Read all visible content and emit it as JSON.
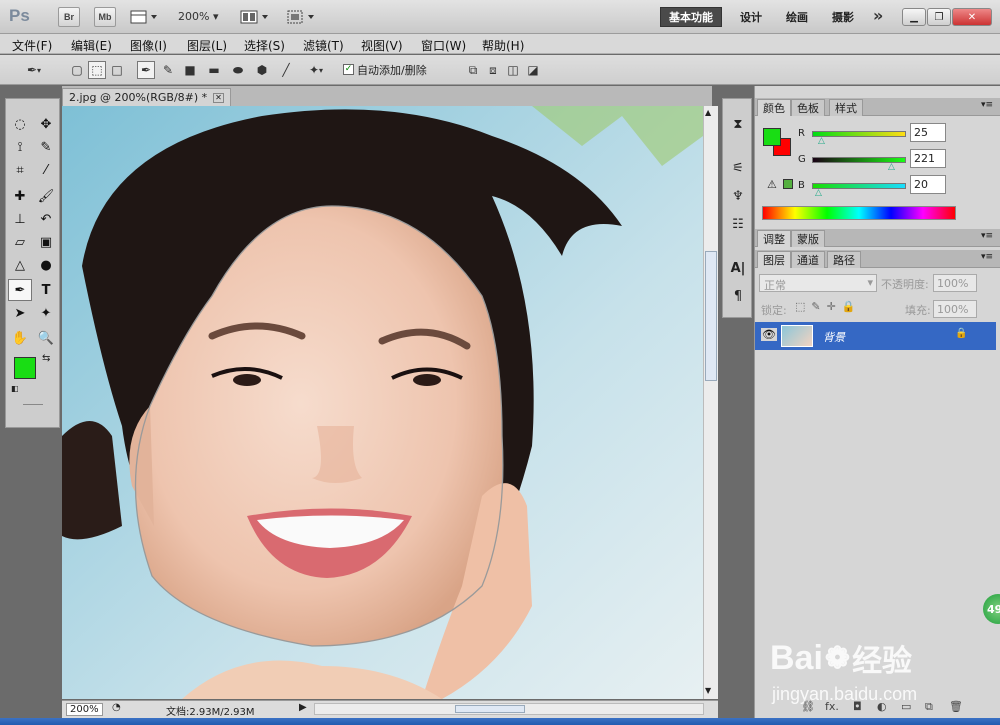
{
  "app": {
    "logo": "Ps",
    "bridge_label": "Br",
    "minibridge_label": "Mb",
    "zoom": "200%"
  },
  "workspaces": [
    "基本功能",
    "设计",
    "绘画",
    "摄影"
  ],
  "more_symbol": "»",
  "menu": [
    "文件(F)",
    "编辑(E)",
    "图像(I)",
    "图层(L)",
    "选择(S)",
    "滤镜(T)",
    "视图(V)",
    "窗口(W)",
    "帮助(H)"
  ],
  "options": {
    "auto_add_delete": "自动添加/删除"
  },
  "document": {
    "tab_title": "2.jpg @ 200%(RGB/8#) *",
    "zoom": "200%",
    "doc_size": "文档:2.93M/2.93M"
  },
  "color_panel": {
    "tabs": [
      "颜色",
      "色板",
      "样式"
    ],
    "r_label": "R",
    "g_label": "G",
    "b_label": "B",
    "r": "25",
    "g": "221",
    "b": "20",
    "fg_color": "#19dd14",
    "bg_color": "#ff0000"
  },
  "adjust_panel": {
    "tabs": [
      "调整",
      "蒙版"
    ]
  },
  "layers_panel": {
    "tabs": [
      "图层",
      "通道",
      "路径"
    ],
    "blend_mode": "正常",
    "opacity_label": "不透明度:",
    "opacity": "100%",
    "lock_label": "锁定:",
    "fill_label": "填充:",
    "fill": "100%",
    "layer_name": "背景"
  },
  "watermark": {
    "site": "jingyan.baidu.com",
    "brand": "Bai",
    "brand2": "经验",
    "badge": "49"
  }
}
